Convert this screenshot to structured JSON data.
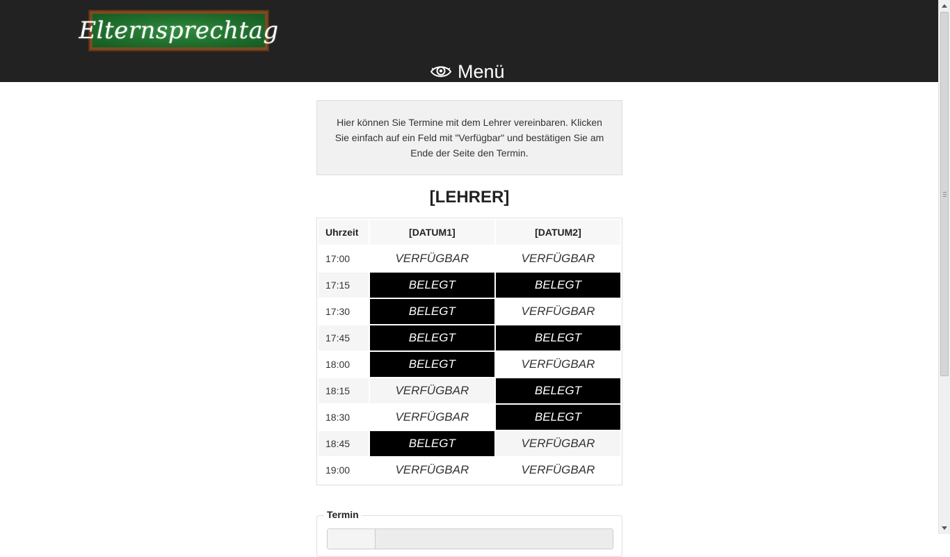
{
  "header": {
    "logo_text": "Elternsprechtag",
    "menu_icon": "eye-icon",
    "menu_label": "Menü",
    "background": "#222222"
  },
  "info": {
    "text": "Hier können Sie Termine mit dem Lehrer vereinbaren. Klicken Sie einfach auf ein Feld mit \"Verfügbar\" und bestätigen Sie am Ende der Seite den Termin."
  },
  "teacher": "[LEHRER]",
  "schedule": {
    "headers": [
      "Uhrzeit",
      "[DATUM1]",
      "[DATUM2]"
    ],
    "rows": [
      {
        "time": "17:00",
        "d1": "VERFÜGBAR",
        "d2": "VERFÜGBAR"
      },
      {
        "time": "17:15",
        "d1": "BELEGT",
        "d2": "BELEGT"
      },
      {
        "time": "17:30",
        "d1": "BELEGT",
        "d2": "VERFÜGBAR"
      },
      {
        "time": "17:45",
        "d1": "BELEGT",
        "d2": "BELEGT"
      },
      {
        "time": "18:00",
        "d1": "BELEGT",
        "d2": "VERFÜGBAR"
      },
      {
        "time": "18:15",
        "d1": "VERFÜGBAR",
        "d2": "BELEGT"
      },
      {
        "time": "18:30",
        "d1": "VERFÜGBAR",
        "d2": "BELEGT"
      },
      {
        "time": "18:45",
        "d1": "BELEGT",
        "d2": "VERFÜGBAR"
      },
      {
        "time": "19:00",
        "d1": "VERFÜGBAR",
        "d2": "VERFÜGBAR"
      }
    ],
    "colors": {
      "taken_bg": "#000000",
      "taken_fg": "#ffffff",
      "free_fg": "#333333"
    }
  },
  "termin": {
    "legend": "Termin"
  }
}
